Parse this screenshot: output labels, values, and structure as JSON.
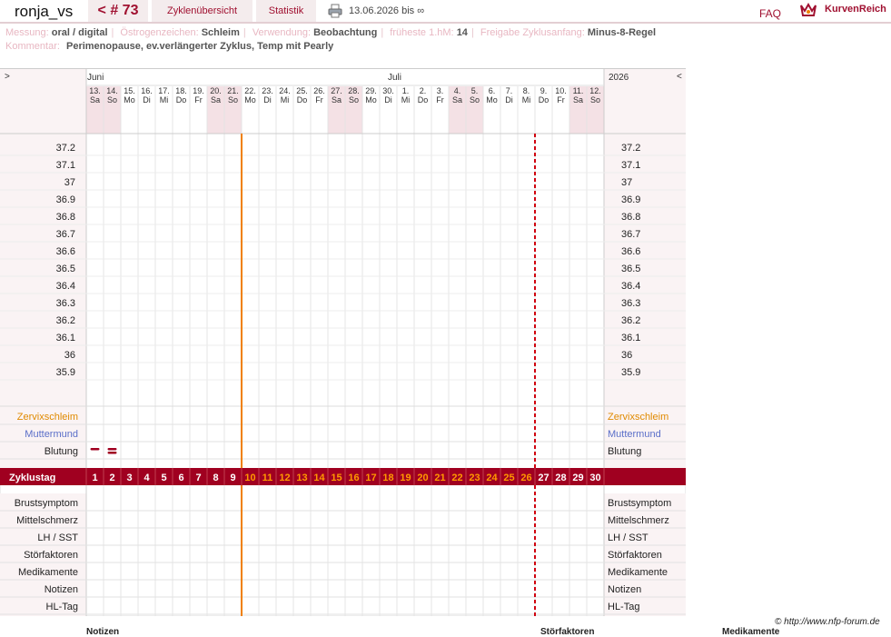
{
  "header": {
    "username": "ronja_vs",
    "cycle_nav": "< # 73",
    "tab_overview": "Zyklenübersicht",
    "tab_statistics": "Statistik",
    "date_range": "13.06.2026 bis ∞",
    "faq": "FAQ",
    "brand": "KurvenReich"
  },
  "info": {
    "measurement_label": "Messung:",
    "measurement_value": "oral / digital",
    "estrogen_label": "Östrogenzeichen:",
    "estrogen_value": "Schleim",
    "usage_label": "Verwendung:",
    "usage_value": "Beobachtung",
    "earliest_label": "früheste 1.hM:",
    "earliest_value": "14",
    "release_label": "Freigabe Zyklusanfang:",
    "release_value": "Minus-8-Regel",
    "comment_label": "Kommentar:",
    "comment_value": "Perimenopause, ev.verlängerter Zyklus, Temp mit Pearly"
  },
  "chart": {
    "nav_left": ">",
    "nav_right": "<",
    "year": "2026",
    "month_june": "Juni",
    "month_july": "Juli",
    "days": [
      {
        "d": "13.",
        "w": "Sa",
        "we": true
      },
      {
        "d": "14.",
        "w": "So",
        "we": true
      },
      {
        "d": "15.",
        "w": "Mo",
        "we": false
      },
      {
        "d": "16.",
        "w": "Di",
        "we": false
      },
      {
        "d": "17.",
        "w": "Mi",
        "we": false
      },
      {
        "d": "18.",
        "w": "Do",
        "we": false
      },
      {
        "d": "19.",
        "w": "Fr",
        "we": false
      },
      {
        "d": "20.",
        "w": "Sa",
        "we": true
      },
      {
        "d": "21.",
        "w": "So",
        "we": true
      },
      {
        "d": "22.",
        "w": "Mo",
        "we": false
      },
      {
        "d": "23.",
        "w": "Di",
        "we": false
      },
      {
        "d": "24.",
        "w": "Mi",
        "we": false
      },
      {
        "d": "25.",
        "w": "Do",
        "we": false
      },
      {
        "d": "26.",
        "w": "Fr",
        "we": false
      },
      {
        "d": "27.",
        "w": "Sa",
        "we": true
      },
      {
        "d": "28.",
        "w": "So",
        "we": true
      },
      {
        "d": "29.",
        "w": "Mo",
        "we": false
      },
      {
        "d": "30.",
        "w": "Di",
        "we": false
      },
      {
        "d": "1.",
        "w": "Mi",
        "we": false
      },
      {
        "d": "2.",
        "w": "Do",
        "we": false
      },
      {
        "d": "3.",
        "w": "Fr",
        "we": false
      },
      {
        "d": "4.",
        "w": "Sa",
        "we": true
      },
      {
        "d": "5.",
        "w": "So",
        "we": true
      },
      {
        "d": "6.",
        "w": "Mo",
        "we": false
      },
      {
        "d": "7.",
        "w": "Di",
        "we": false
      },
      {
        "d": "8.",
        "w": "Mi",
        "we": false
      },
      {
        "d": "9.",
        "w": "Do",
        "we": false
      },
      {
        "d": "10.",
        "w": "Fr",
        "we": false
      },
      {
        "d": "11.",
        "w": "Sa",
        "we": true
      },
      {
        "d": "12.",
        "w": "So",
        "we": true
      }
    ],
    "temps": [
      "37.2",
      "37.1",
      "37",
      "36.9",
      "36.8",
      "36.7",
      "36.6",
      "36.5",
      "36.4",
      "36.3",
      "36.2",
      "36.1",
      "36",
      "35.9"
    ],
    "rows_top": [
      {
        "label": "Zervixschleim",
        "color": "#e08a00"
      },
      {
        "label": "Muttermund",
        "color": "#5a6ec8"
      },
      {
        "label": "Blutung",
        "color": "#222222"
      }
    ],
    "cycle_label": "Zyklustag",
    "cycle_days": [
      1,
      2,
      3,
      4,
      5,
      6,
      7,
      8,
      9,
      10,
      11,
      12,
      13,
      14,
      15,
      16,
      17,
      18,
      19,
      20,
      21,
      22,
      23,
      24,
      25,
      26,
      27,
      28,
      29,
      30
    ],
    "cycle_highlight_from": 10,
    "cycle_highlight_to": 26,
    "rows_bottom": [
      "Brustsymptom",
      "Mittelschmerz",
      "LH / SST",
      "Störfaktoren",
      "Medikamente",
      "Notizen",
      "HL-Tag"
    ],
    "bleeding": [
      {
        "day": 1,
        "level": 1
      },
      {
        "day": 2,
        "level": 2
      }
    ],
    "solid_line_after_day": 9,
    "dashed_line_after_day": 26,
    "colors": {
      "accent": "#a00020",
      "orange": "#f08000",
      "highlight": "#ff9900",
      "weekend": "#f4e1e5",
      "panel": "#faf3f4"
    }
  },
  "footer": {
    "copyright": "© http://www.nfp-forum.de",
    "notes": "Notizen",
    "disturbances": "Störfaktoren",
    "medication": "Medikamente"
  }
}
